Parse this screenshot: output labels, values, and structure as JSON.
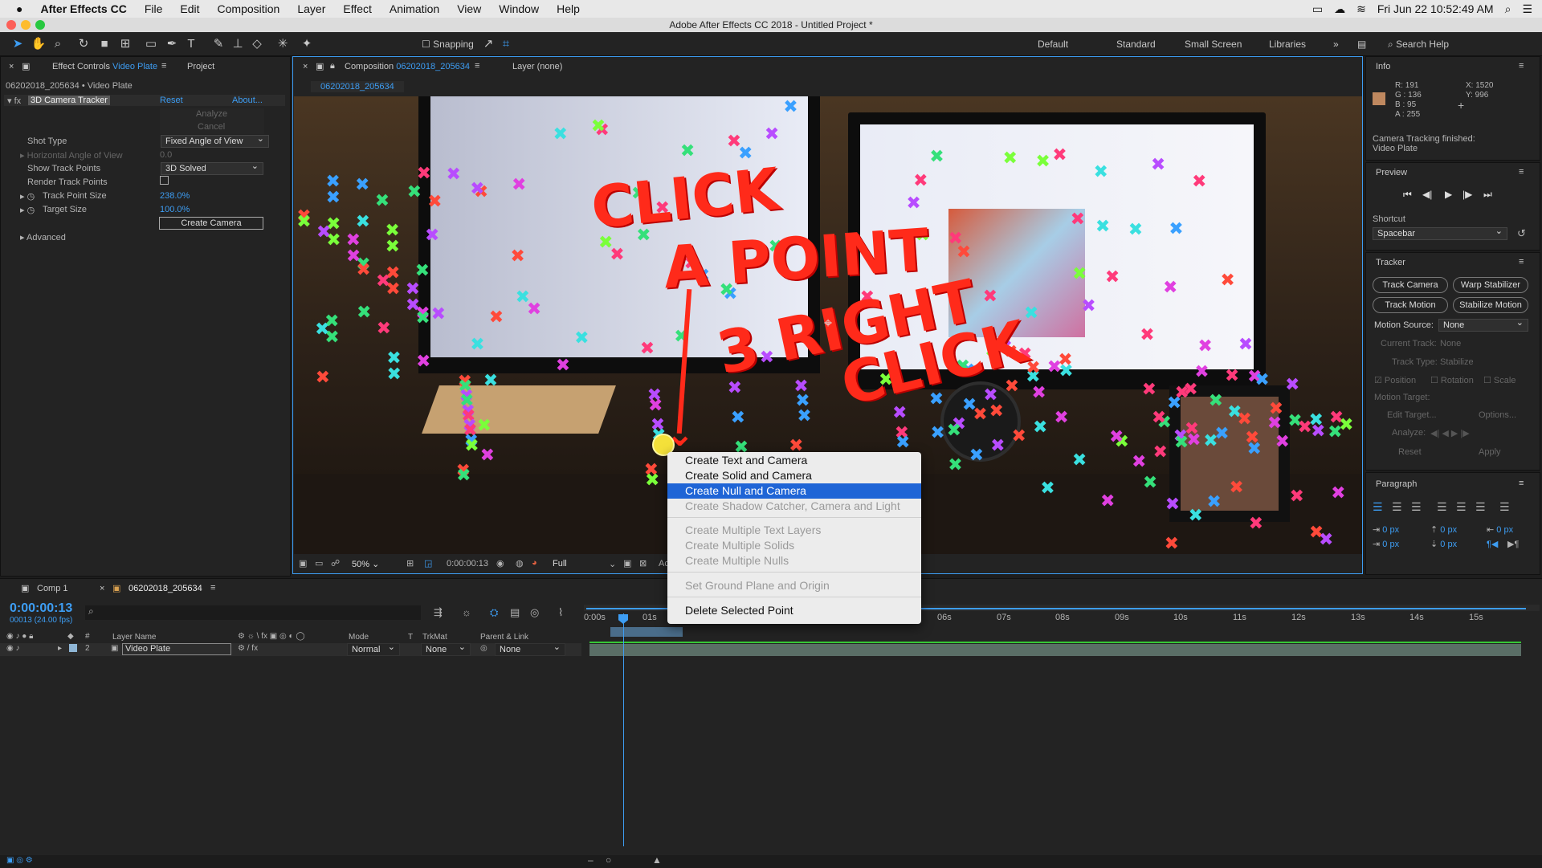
{
  "menubar": {
    "app": "After Effects CC",
    "items": [
      "File",
      "Edit",
      "Composition",
      "Layer",
      "Effect",
      "Animation",
      "View",
      "Window",
      "Help"
    ],
    "clock": "Fri Jun 22  10:52:49 AM"
  },
  "window_title": "Adobe After Effects CC 2018 - Untitled Project *",
  "toolbar": {
    "snapping": "Snapping",
    "workspaces": [
      "Default",
      "Standard",
      "Small Screen",
      "Libraries"
    ],
    "search": "Search Help"
  },
  "effect_panel": {
    "tab_prefix": "Effect Controls",
    "tab_layer": "Video Plate",
    "tab_project": "Project",
    "breadcrumb": "06202018_205634 • Video Plate",
    "effect_name": "3D Camera Tracker",
    "reset": "Reset",
    "about": "About...",
    "analyze": "Analyze",
    "cancel": "Cancel",
    "shot_type_label": "Shot Type",
    "shot_type_value": "Fixed Angle of View",
    "hfov_label": "Horizontal Angle of View",
    "hfov_value": "0.0",
    "show_tp_label": "Show Track Points",
    "show_tp_value": "3D Solved",
    "render_tp_label": "Render Track Points",
    "tps_label": "Track Point Size",
    "tps_value": "238.0%",
    "ts_label": "Target Size",
    "ts_value": "100.0%",
    "create_camera": "Create Camera",
    "advanced": "Advanced"
  },
  "comp_panel": {
    "tab_prefix": "Composition",
    "tab_comp": "06202018_205634",
    "layer_tab": "Layer (none)",
    "subtab": "06202018_205634",
    "zoom": "50%",
    "timecode": "0:00:00:13",
    "resolution": "Full",
    "footer_tail": "Ac"
  },
  "annotation": {
    "line1": "CLICK",
    "line2": "A POINT",
    "line3": "3 RIGHT",
    "line4": "CLICK"
  },
  "context_menu": {
    "items": [
      "Create Text and Camera",
      "Create Solid and Camera",
      "Create Null and Camera",
      "Create Shadow Catcher, Camera and Light",
      "Create Multiple Text Layers",
      "Create Multiple Solids",
      "Create Multiple Nulls",
      "Set Ground Plane and Origin",
      "Delete Selected Point"
    ]
  },
  "info": {
    "title": "Info",
    "r": "R: 191",
    "g": "G : 136",
    "b": "B : 95",
    "a": "A : 255",
    "x": "X: 1520",
    "y": "Y: 996",
    "swatch": "#bf885f",
    "msg1": "Camera Tracking finished:",
    "msg2": "Video Plate"
  },
  "preview": {
    "title": "Preview",
    "shortcut_label": "Shortcut",
    "shortcut_value": "Spacebar"
  },
  "tracker": {
    "title": "Tracker",
    "track_camera": "Track Camera",
    "warp": "Warp Stabilizer",
    "track_motion": "Track Motion",
    "stabilize": "Stabilize Motion",
    "motion_source_label": "Motion Source:",
    "motion_source": "None",
    "current_track_label": "Current Track:",
    "current_track": "None",
    "track_type_label": "Track Type:",
    "track_type": "Stabilize",
    "position": "Position",
    "rotation": "Rotation",
    "scale": "Scale",
    "motion_target": "Motion Target:",
    "edit_target": "Edit Target...",
    "options": "Options...",
    "analyze": "Analyze:",
    "reset": "Reset",
    "apply": "Apply"
  },
  "paragraph": {
    "title": "Paragraph",
    "v1": "0 px",
    "v2": "0 px",
    "v3": "0 px",
    "v4": "0 px",
    "v5": "0 px"
  },
  "timeline": {
    "tab1": "Comp 1",
    "tab2": "06202018_205634",
    "timecode": "0:00:00:13",
    "frames": "00013 (24.00 fps)",
    "col_layer": "Layer Name",
    "col_mode": "Mode",
    "col_t": "T",
    "col_trkmat": "TrkMat",
    "col_parent": "Parent & Link",
    "layer_num": "2",
    "layer_name": "Video Plate",
    "layer_mode": "Normal",
    "layer_trkmat": "None",
    "layer_parent": "None",
    "ticks": [
      "0:00s",
      "01s",
      "06s",
      "07s",
      "08s",
      "09s",
      "10s",
      "11s",
      "12s",
      "13s",
      "14s",
      "15s"
    ]
  }
}
